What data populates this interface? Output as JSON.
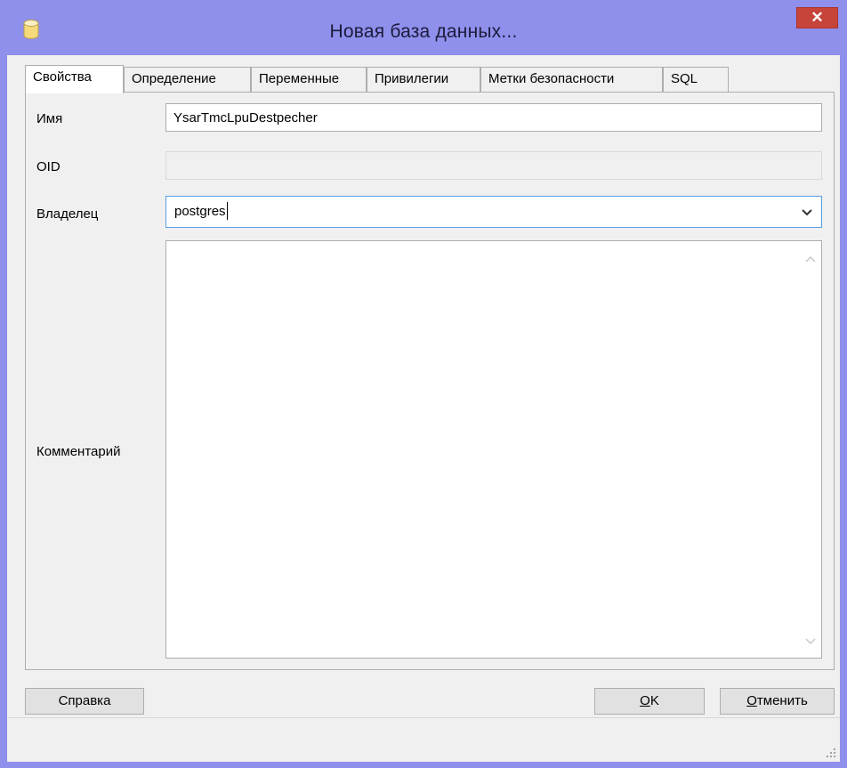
{
  "window": {
    "title": "Новая база данных...",
    "close_label": "✕",
    "accent_color": "#8f8fec"
  },
  "tabs": [
    {
      "label": "Свойства",
      "active": true
    },
    {
      "label": "Определение"
    },
    {
      "label": "Переменные"
    },
    {
      "label": "Привилегии"
    },
    {
      "label": "Метки безопасности"
    },
    {
      "label": "SQL"
    }
  ],
  "form": {
    "name_label": "Имя",
    "name_value": "YsarTmcLpuDestpecher",
    "oid_label": "OID",
    "oid_value": "",
    "owner_label": "Владелец",
    "owner_value": "postgres",
    "comment_label": "Комментарий",
    "comment_value": ""
  },
  "buttons": {
    "help_label": "Справка",
    "ok_mnemonic": "O",
    "ok_rest": "K",
    "cancel_mnemonic": "О",
    "cancel_rest": "тменить"
  },
  "icons": {
    "app": "database-icon",
    "owner_dropdown": "chevron-down-icon",
    "scroll_up": "chevron-up-icon",
    "scroll_down": "chevron-down-icon",
    "resize": "resize-grip-icon"
  }
}
